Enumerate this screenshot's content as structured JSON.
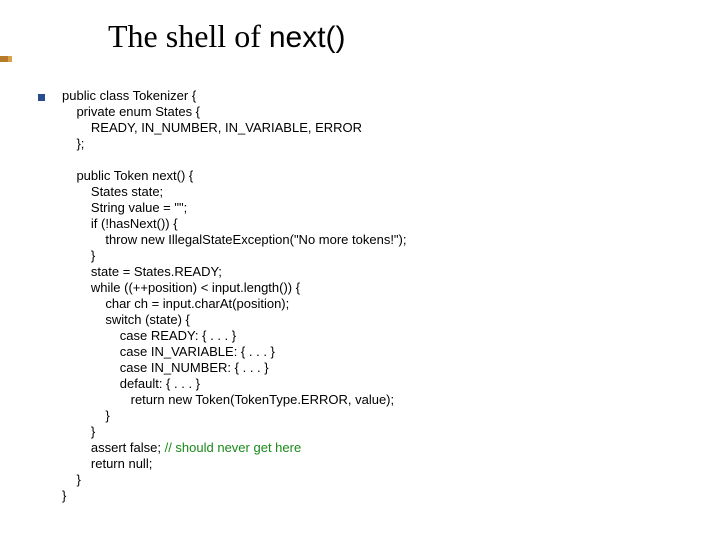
{
  "title": {
    "prefix": "The shell of ",
    "fn": "next()"
  },
  "code": {
    "l01": "public class Tokenizer {",
    "l02": "    private enum States {",
    "l03": "        READY, IN_NUMBER, IN_VARIABLE, ERROR",
    "l04": "    };",
    "l05": "",
    "l06": "    public Token next() {",
    "l07": "        States state;",
    "l08": "        String value = \"\";",
    "l09": "        if (!hasNext()) {",
    "l10": "            throw new IllegalStateException(\"No more tokens!\");",
    "l11": "        }",
    "l12": "        state = States.READY;",
    "l13": "        while ((++position) < input.length()) {",
    "l14": "            char ch = input.charAt(position);",
    "l15": "            switch (state) {",
    "l16": "                case READY: { . . . }",
    "l17": "                case IN_VARIABLE: { . . . }",
    "l18": "                case IN_NUMBER: { . . . }",
    "l19": "                default: { . . . }",
    "l20": "                   return new Token(TokenType.ERROR, value);",
    "l21": "            }",
    "l22": "        }",
    "l23a": "        assert false; ",
    "l23b": "// should never get here",
    "l24": "        return null;",
    "l25": "    }",
    "l26": "}"
  }
}
